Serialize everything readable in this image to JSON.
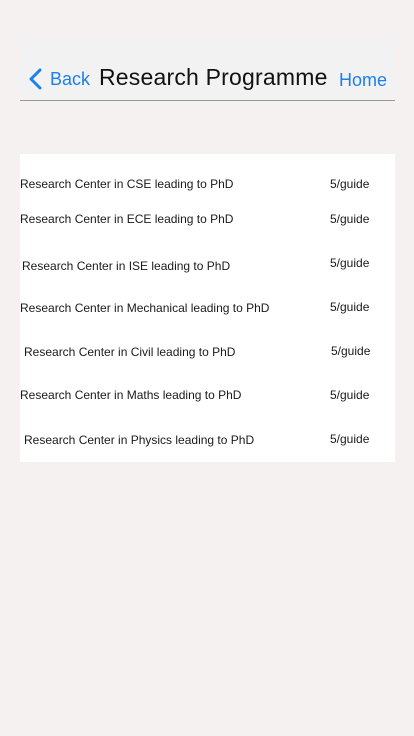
{
  "nav": {
    "back_label": "Back",
    "title": "Research Programme",
    "home_label": "Home",
    "accent_color": "#1b7ff0"
  },
  "rows": [
    {
      "label": "Research Center in CSE leading to PhD",
      "value": "5/guide"
    },
    {
      "label": "Research Center in ECE leading to PhD",
      "value": "5/guide"
    },
    {
      "label": "Research Center in ISE leading to PhD",
      "value": "5/guide"
    },
    {
      "label": "Research Center in Mechanical leading to PhD",
      "value": "5/guide"
    },
    {
      "label": "Research Center in Civil leading to PhD",
      "value": "5/guide"
    },
    {
      "label": "Research Center in Maths leading to PhD",
      "value": "5/guide"
    },
    {
      "label": "Research Center in Physics leading to PhD",
      "value": "5/guide"
    }
  ]
}
